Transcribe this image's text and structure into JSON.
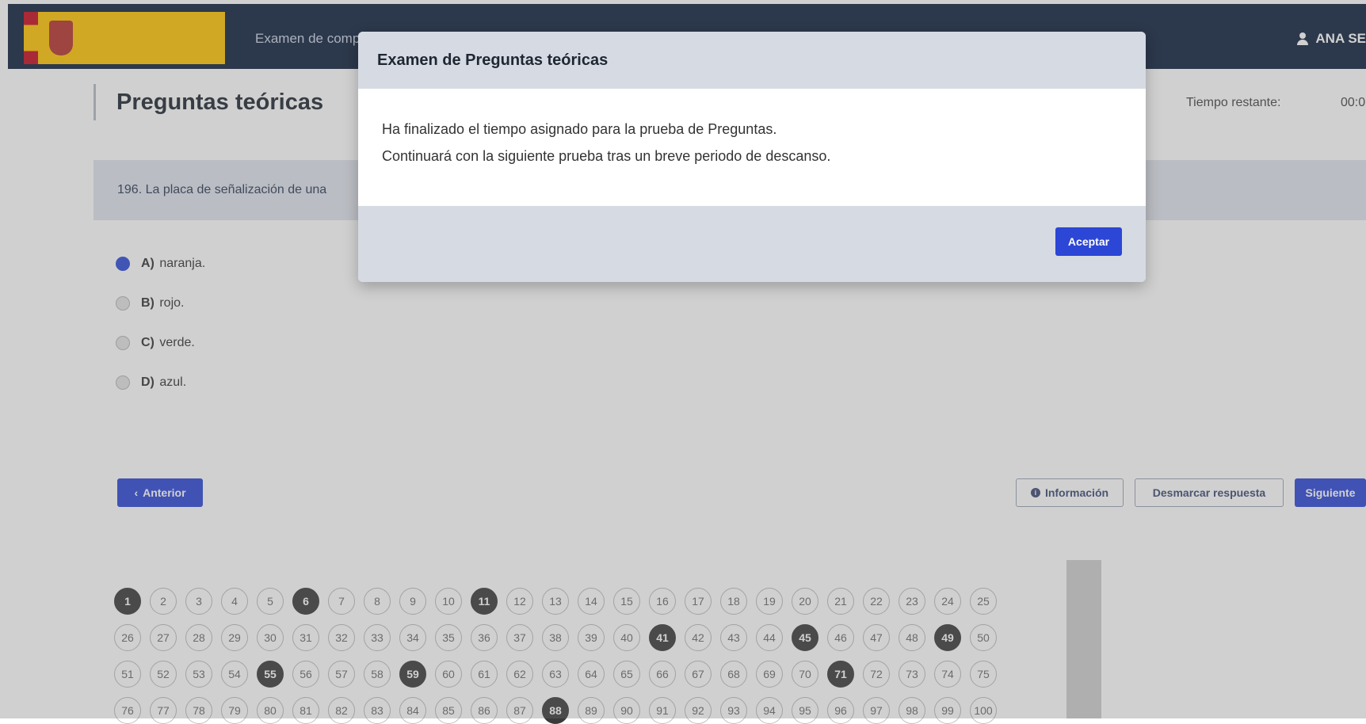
{
  "header": {
    "nav_title": "Examen de comp",
    "user_name": "ANA SE",
    "icons": {
      "user": "user-icon",
      "logo": "government-logo"
    }
  },
  "page": {
    "title": "Preguntas teóricas",
    "time_label": "Tiempo restante:",
    "time_value": "00:0"
  },
  "question": {
    "text": "196. La placa de señalización de una",
    "answers": [
      {
        "letter": "A)",
        "text": "naranja.",
        "selected": true
      },
      {
        "letter": "B)",
        "text": "rojo.",
        "selected": false
      },
      {
        "letter": "C)",
        "text": "verde.",
        "selected": false
      },
      {
        "letter": "D)",
        "text": "azul.",
        "selected": false
      }
    ]
  },
  "buttons": {
    "prev": "Anterior",
    "info": "Información",
    "unmark": "Desmarcar respuesta",
    "next": "Siguiente"
  },
  "question_grid": {
    "numbers": [
      "1",
      "2",
      "3",
      "4",
      "5",
      "6",
      "7",
      "8",
      "9",
      "10",
      "11",
      "12",
      "13",
      "14",
      "15",
      "16",
      "17",
      "18",
      "19",
      "20",
      "21",
      "22",
      "23",
      "24",
      "25",
      "26",
      "27",
      "28",
      "29",
      "30",
      "31",
      "32",
      "33",
      "34",
      "35",
      "36",
      "37",
      "38",
      "39",
      "40",
      "41",
      "42",
      "43",
      "44",
      "45",
      "46",
      "47",
      "48",
      "49",
      "50",
      "51",
      "52",
      "53",
      "54",
      "55",
      "56",
      "57",
      "58",
      "59",
      "60",
      "61",
      "62",
      "63",
      "64",
      "65",
      "66",
      "67",
      "68",
      "69",
      "70",
      "71",
      "72",
      "73",
      "74",
      "75",
      "76",
      "77",
      "78",
      "79",
      "80",
      "81",
      "82",
      "83",
      "84",
      "85",
      "86",
      "87",
      "88",
      "89",
      "90",
      "91",
      "92",
      "93",
      "94",
      "95",
      "96",
      "97",
      "98",
      "99",
      "100"
    ],
    "answered": [
      "1",
      "6",
      "11",
      "41",
      "45",
      "49",
      "55",
      "59",
      "71",
      "88"
    ]
  },
  "modal": {
    "title": "Examen de Preguntas teóricas",
    "line1": "Ha finalizado el tiempo asignado para la prueba de Preguntas.",
    "line2": "Continuará con la siguiente prueba tras un breve periodo de descanso.",
    "accept": "Aceptar"
  },
  "colors": {
    "topbar": "#0e1f3c",
    "primary": "#2c46d6",
    "answered": "#3a3a3a"
  }
}
